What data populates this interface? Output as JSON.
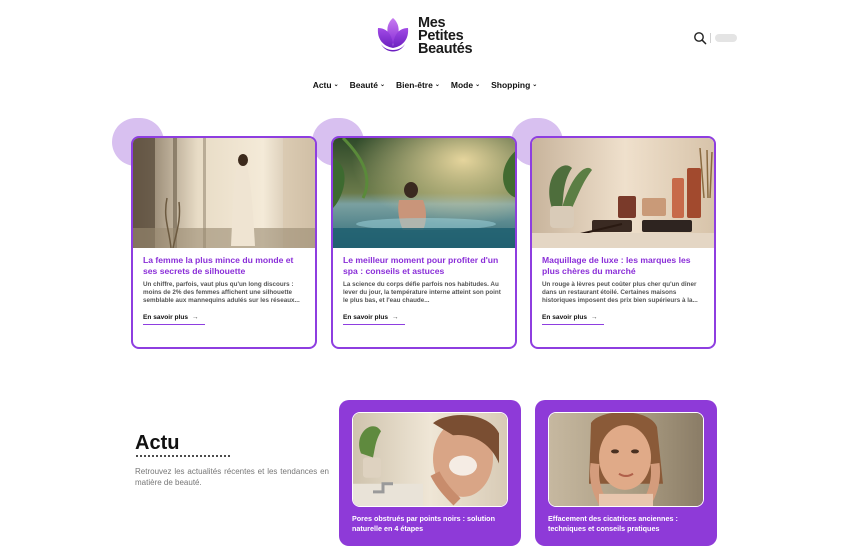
{
  "header": {
    "logo_lines": [
      "Mes",
      "Petites",
      "Beautés"
    ]
  },
  "nav": {
    "items": [
      {
        "label": "Actu"
      },
      {
        "label": "Beauté"
      },
      {
        "label": "Bien-être"
      },
      {
        "label": "Mode"
      },
      {
        "label": "Shopping"
      }
    ]
  },
  "featured": [
    {
      "title": "La femme la plus mince du monde et ses secrets de silhouette",
      "excerpt": "Un chiffre, parfois, vaut plus qu'un long discours : moins de 2% des femmes affichent une silhouette semblable aux mannequins adulés sur les réseaux...",
      "link": "En savoir plus",
      "arrow": "→"
    },
    {
      "title": "Le meilleur moment pour profiter d'un spa : conseils et astuces",
      "excerpt": "La science du corps défie parfois nos habitudes. Au lever du jour, la température interne atteint son point le plus bas, et l'eau chaude...",
      "link": "En savoir plus",
      "arrow": "→"
    },
    {
      "title": "Maquillage de luxe : les marques les plus chères du marché",
      "excerpt": "Un rouge à lèvres peut coûter plus cher qu'un dîner dans un restaurant étoilé. Certaines maisons historiques imposent des prix bien supérieurs à la...",
      "link": "En savoir plus",
      "arrow": "→"
    }
  ],
  "actu": {
    "title": "Actu",
    "description": "Retrouvez les actualités récentes et les tendances en matière de beauté.",
    "posts": [
      {
        "title": "Pores obstrués par points noirs : solution naturelle en 4 étapes"
      },
      {
        "title": "Effacement des cicatrices anciennes : techniques et conseils pratiques"
      }
    ]
  },
  "colors": {
    "accent": "#8e3ee0",
    "accent_dark": "#8a2ed8",
    "blob": "#d8c0f0",
    "card_bg": "#8e3ad8"
  }
}
